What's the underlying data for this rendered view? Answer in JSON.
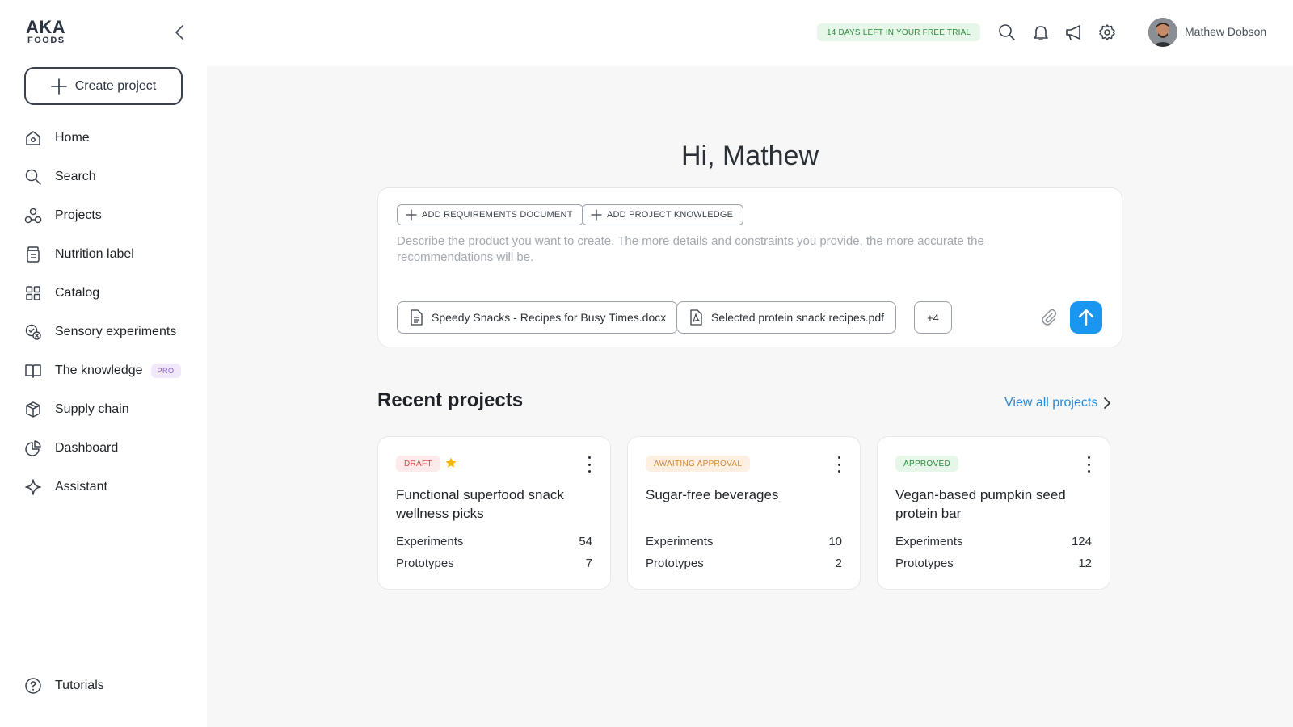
{
  "brand": {
    "line1": "AKA",
    "line2": "FOODS"
  },
  "sidebar": {
    "create_label": "Create project",
    "items": [
      {
        "label": "Home",
        "icon": "home-icon"
      },
      {
        "label": "Search",
        "icon": "search-icon"
      },
      {
        "label": "Projects",
        "icon": "projects-icon"
      },
      {
        "label": "Nutrition label",
        "icon": "jar-icon"
      },
      {
        "label": "Catalog",
        "icon": "grid-icon"
      },
      {
        "label": "Sensory experiments",
        "icon": "sensory-icon"
      },
      {
        "label": "The knowledge",
        "icon": "book-icon",
        "badge": "PRO"
      },
      {
        "label": "Supply chain",
        "icon": "box-icon"
      },
      {
        "label": "Dashboard",
        "icon": "pie-chart-icon"
      },
      {
        "label": "Assistant",
        "icon": "sparkle-icon"
      }
    ],
    "footer": {
      "label": "Tutorials",
      "icon": "help-icon"
    }
  },
  "header": {
    "trial": "14 DAYS LEFT IN YOUR FREE TRIAL",
    "user_name": "Mathew Dobson"
  },
  "main": {
    "greeting": "Hi, Mathew",
    "composer": {
      "add_requirements": "ADD REQUIREMENTS DOCUMENT",
      "add_knowledge": "ADD PROJECT KNOWLEDGE",
      "placeholder": "Describe the product you want to create. The more details and constraints you provide, the more accurate the recommendations will be.",
      "files": [
        {
          "name": "Speedy Snacks - Recipes for Busy Times.docx",
          "icon": "doc-icon"
        },
        {
          "name": "Selected protein snack recipes.pdf",
          "icon": "pdf-icon"
        }
      ],
      "more": "+4"
    },
    "recent_title": "Recent projects",
    "view_all": "View all projects",
    "projects": [
      {
        "status": "DRAFT",
        "title": "Functional superfood snack wellness picks",
        "exp_label": "Experiments",
        "experiments": "54",
        "proto_label": "Prototypes",
        "prototypes": "7",
        "starred": true
      },
      {
        "status": "AWAITING APPROVAL",
        "title": "Sugar-free beverages",
        "exp_label": "Experiments",
        "experiments": "10",
        "proto_label": "Prototypes",
        "prototypes": "2",
        "starred": false
      },
      {
        "status": "APPROVED",
        "title": "Vegan-based pumpkin seed protein bar",
        "exp_label": "Experiments",
        "experiments": "124",
        "proto_label": "Prototypes",
        "prototypes": "12",
        "starred": false
      }
    ]
  },
  "colors": {
    "accent": "#1a96f0",
    "link": "#2a8ad8",
    "star": "#f5b800"
  }
}
